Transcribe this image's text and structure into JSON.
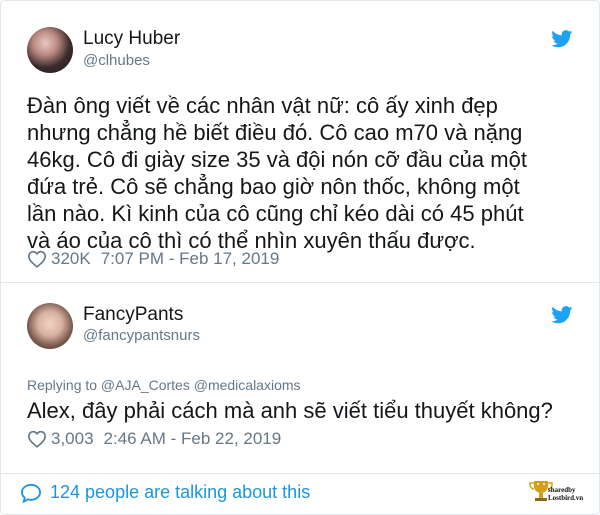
{
  "tweets": [
    {
      "name": "Lucy Huber",
      "handle": "@clhubes",
      "text_lines": [
        "Đàn ông viết về các nhân vật nữ: cô ấy xinh đẹp",
        "nhưng chẳng hề biết điều đó. Cô cao m70 và nặng",
        "46kg. Cô đi giày size 35 và đội nón cỡ đầu của một",
        "đứa trẻ. Cô sẽ chẳng bao giờ nôn thốc, không một",
        "lần nào. Kì kinh của cô cũng chỉ kéo dài có 45 phút",
        "và áo của cô thì có thể nhìn xuyên thấu được."
      ],
      "likes": "320K",
      "time": "7:07 PM - Feb 17, 2019"
    },
    {
      "name": "FancyPants",
      "handle": "@fancypantsnurs",
      "replying_to": "Replying to @AJA_Cortes @medicalaxioms",
      "text": "Alex, đây phải cách mà anh sẽ viết tiểu thuyết không?",
      "likes": "3,003",
      "time": "2:46 AM - Feb 22, 2019"
    }
  ],
  "footer": {
    "talking": "124 people are talking about this",
    "logo_line1": "sharedby",
    "logo_line2": "Lostbird.vn"
  },
  "colors": {
    "twitter_blue": "#1da1f2",
    "link_blue": "#1b95e0",
    "muted": "#657786",
    "text": "#14171a"
  },
  "icons": [
    "twitter-bird-icon",
    "heart-icon",
    "speech-bubble-icon",
    "trophy-logo-icon"
  ]
}
